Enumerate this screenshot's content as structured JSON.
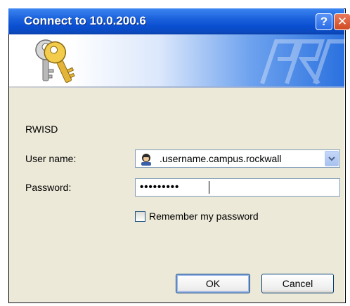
{
  "window": {
    "title": "Connect to 10.0.200.6",
    "help_label": "?",
    "close_label": "✕"
  },
  "icons": {
    "banner_icon": "keys-icon",
    "banner_logo": "brand-logo",
    "user_icon": "user-icon",
    "dropdown_icon": "chevron-down-icon"
  },
  "form": {
    "server_label": "RWISD",
    "username_label": "User name:",
    "username_value": ".username.campus.rockwall",
    "password_label": "Password:",
    "password_value": "•••••••••",
    "remember_label": "Remember my password",
    "remember_checked": false
  },
  "buttons": {
    "ok_label": "OK",
    "cancel_label": "Cancel"
  },
  "colors": {
    "titlebar": "#0a4fd1",
    "dialog_body": "#ece9d8",
    "field_border": "#7f9db9"
  }
}
